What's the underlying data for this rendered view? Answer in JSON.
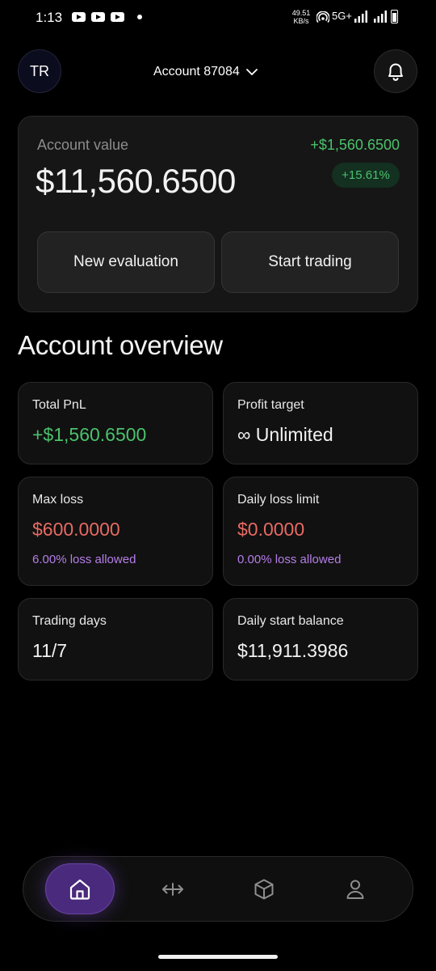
{
  "status_bar": {
    "time": "1:13",
    "net_speed": "49.51",
    "net_unit": "KB/s",
    "network": "5G+"
  },
  "header": {
    "avatar_initials": "TR",
    "account_label": "Account 87084"
  },
  "value_card": {
    "label": "Account value",
    "amount": "$11,560.6500",
    "change": "+$1,560.6500",
    "change_pct": "+15.61%",
    "new_evaluation_label": "New evaluation",
    "start_trading_label": "Start trading"
  },
  "overview": {
    "title": "Account overview",
    "total_pnl": {
      "label": "Total PnL",
      "value": "+$1,560.6500"
    },
    "profit_target": {
      "label": "Profit target",
      "value": "∞ Unlimited"
    },
    "max_loss": {
      "label": "Max loss",
      "value": "$600.0000",
      "sub": "6.00% loss allowed"
    },
    "daily_loss_limit": {
      "label": "Daily loss limit",
      "value": "$0.0000",
      "sub": "0.00% loss allowed"
    },
    "trading_days": {
      "label": "Trading days",
      "value": "11/7"
    },
    "daily_start_balance": {
      "label": "Daily start balance",
      "value": "$11,911.3986"
    }
  },
  "colors": {
    "positive": "#4ac26b",
    "negative": "#e86a63",
    "accent": "#b57ee8",
    "nav_active": "#4a2a7c"
  },
  "nav": {
    "items": [
      "home-icon",
      "swap-arrows-icon",
      "cube-icon",
      "user-icon"
    ],
    "active": "home-icon"
  }
}
